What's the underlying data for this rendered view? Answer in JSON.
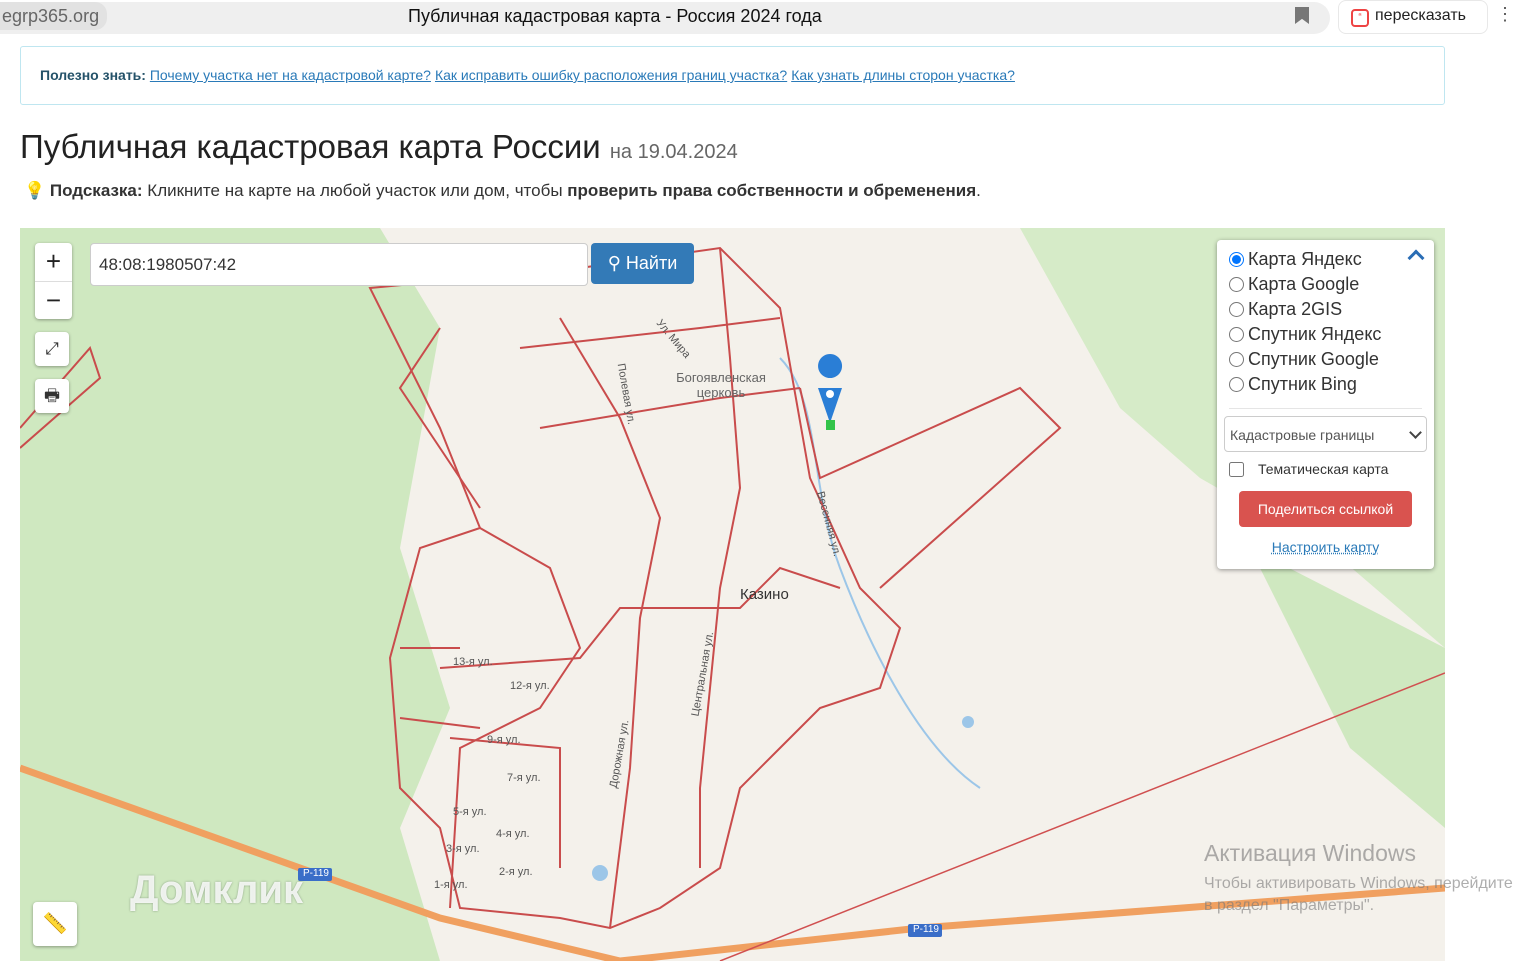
{
  "browser": {
    "domain": "egrp365.org",
    "title": "Публичная кадастровая карта - Россия 2024 года",
    "retell_label": "пересказать"
  },
  "info": {
    "prefix": "Полезно знать:",
    "links": [
      "Почему участка нет на кадастровой карте?",
      "Как исправить ошибку расположения границ участка?",
      "Как узнать длины сторон участка?"
    ]
  },
  "header": {
    "title": "Публичная кадастровая карта России",
    "date": "на 19.04.2024"
  },
  "hint": {
    "label": "Подсказка:",
    "text": " Кликните на карте на любой участок или дом, чтобы ",
    "bold": "проверить права собственности и обременения",
    "end": "."
  },
  "map": {
    "search_value": "48:08:1980507:42",
    "find_label": "Найти",
    "zoom_in": "+",
    "zoom_out": "−",
    "layers": [
      "Карта Яндекс",
      "Карта Google",
      "Карта 2GIS",
      "Спутник Яндекс",
      "Спутник Google",
      "Спутник Bing"
    ],
    "selected_layer": 0,
    "overlay_select": "Кадастровые границы",
    "thematic_label": "Тематическая карта",
    "share_label": "Поделиться ссылкой",
    "configure_label": "Настроить карту",
    "labels": {
      "town": "Казино",
      "church": "Богоявленская церковь",
      "streets": [
        "13-я ул.",
        "12-я ул.",
        "9-я ул.",
        "7-я ул.",
        "5-я ул.",
        "4-я ул.",
        "3-я ул.",
        "2-я ул.",
        "1-я ул.",
        "Центральная ул.",
        "Дорожная ул.",
        "Весенняя ул.",
        "Ул. Мира",
        "Полевая ул."
      ],
      "road": "Р-119",
      "road2": "Р-119"
    },
    "watermark": "Домклик"
  },
  "windows": {
    "title": "Активация Windows",
    "text": "Чтобы активировать Windows, перейдите в раздел \"Параметры\"."
  }
}
